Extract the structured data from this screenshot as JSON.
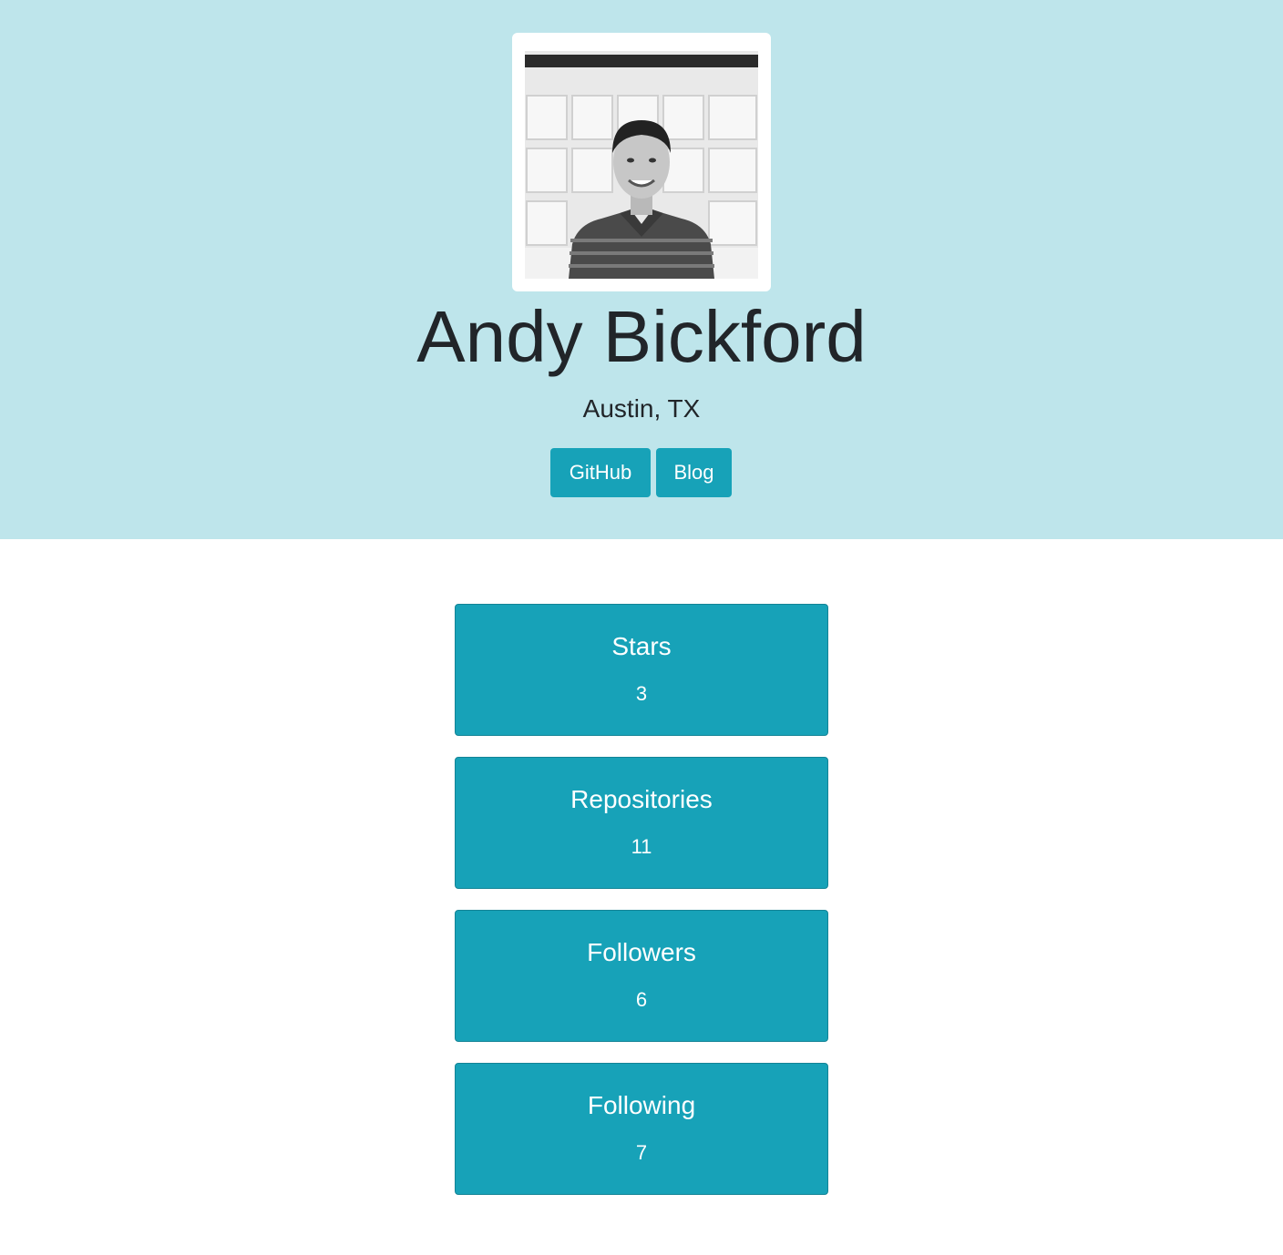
{
  "profile": {
    "name": "Andy Bickford",
    "location": "Austin, TX",
    "avatar_alt": "profile-photo"
  },
  "links": {
    "github_label": "GitHub",
    "blog_label": "Blog"
  },
  "stats": [
    {
      "label": "Stars",
      "value": "3"
    },
    {
      "label": "Repositories",
      "value": "11"
    },
    {
      "label": "Followers",
      "value": "6"
    },
    {
      "label": "Following",
      "value": "7"
    }
  ],
  "colors": {
    "header_bg": "#bee5eb",
    "accent": "#17a2b8",
    "text": "#212529"
  }
}
